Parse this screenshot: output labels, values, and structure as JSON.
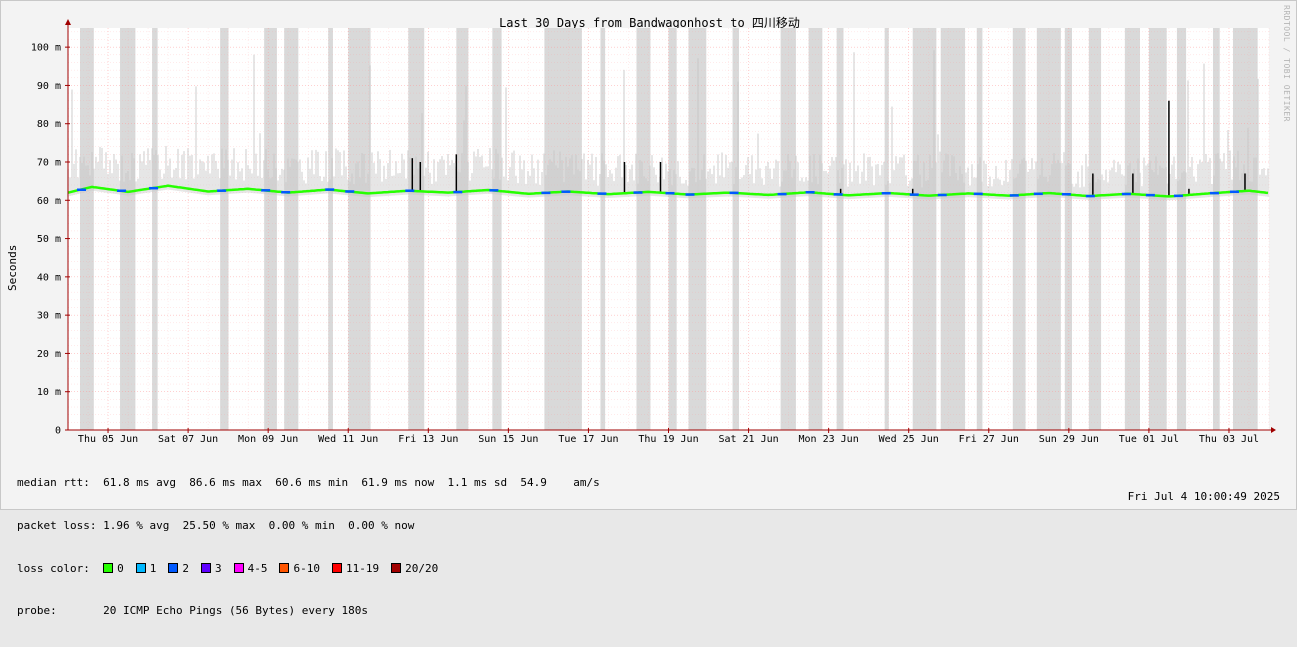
{
  "chart_data": {
    "type": "line",
    "title": "Last 30 Days from Bandwagonhost to 四川移动",
    "ylabel": "Seconds",
    "ylim": [
      0,
      105
    ],
    "y_ticks": [
      {
        "value": 0,
        "label": "0"
      },
      {
        "value": 10,
        "label": "10 m"
      },
      {
        "value": 20,
        "label": "20 m"
      },
      {
        "value": 30,
        "label": "30 m"
      },
      {
        "value": 40,
        "label": "40 m"
      },
      {
        "value": 50,
        "label": "50 m"
      },
      {
        "value": 60,
        "label": "60 m"
      },
      {
        "value": 70,
        "label": "70 m"
      },
      {
        "value": 80,
        "label": "80 m"
      },
      {
        "value": 90,
        "label": "90 m"
      },
      {
        "value": 100,
        "label": "100 m"
      }
    ],
    "x_tick_labels": [
      "Thu 05 Jun",
      "Sat 07 Jun",
      "Mon 09 Jun",
      "Wed 11 Jun",
      "Fri 13 Jun",
      "Sun 15 Jun",
      "Tue 17 Jun",
      "Thu 19 Jun",
      "Sat 21 Jun",
      "Mon 23 Jun",
      "Wed 25 Jun",
      "Fri 27 Jun",
      "Sun 29 Jun",
      "Tue 01 Jul",
      "Thu 03 Jul"
    ],
    "x_days_span": 30,
    "median_rtt_ms": [
      {
        "day": 0,
        "value": 62.0
      },
      {
        "day": 0.6,
        "value": 63.5
      },
      {
        "day": 1.5,
        "value": 62.2
      },
      {
        "day": 2.5,
        "value": 63.8
      },
      {
        "day": 3.5,
        "value": 62.3
      },
      {
        "day": 4.5,
        "value": 63.0
      },
      {
        "day": 5.5,
        "value": 62.0
      },
      {
        "day": 6.5,
        "value": 62.8
      },
      {
        "day": 7.5,
        "value": 61.8
      },
      {
        "day": 8.5,
        "value": 62.5
      },
      {
        "day": 9.5,
        "value": 62.0
      },
      {
        "day": 10.5,
        "value": 62.7
      },
      {
        "day": 11.5,
        "value": 61.7
      },
      {
        "day": 12.5,
        "value": 62.3
      },
      {
        "day": 13.5,
        "value": 61.6
      },
      {
        "day": 14.5,
        "value": 62.2
      },
      {
        "day": 15.5,
        "value": 61.5
      },
      {
        "day": 16.5,
        "value": 62.0
      },
      {
        "day": 17.5,
        "value": 61.4
      },
      {
        "day": 18.5,
        "value": 62.1
      },
      {
        "day": 19.5,
        "value": 61.3
      },
      {
        "day": 20.5,
        "value": 61.9
      },
      {
        "day": 21.5,
        "value": 61.2
      },
      {
        "day": 22.5,
        "value": 61.8
      },
      {
        "day": 23.5,
        "value": 61.2
      },
      {
        "day": 24.5,
        "value": 61.9
      },
      {
        "day": 25.5,
        "value": 61.1
      },
      {
        "day": 26.5,
        "value": 61.7
      },
      {
        "day": 27.5,
        "value": 61.0
      },
      {
        "day": 28.5,
        "value": 61.8
      },
      {
        "day": 29.5,
        "value": 62.5
      },
      {
        "day": 30,
        "value": 61.9
      }
    ],
    "spikes_ms": [
      {
        "day": 8.6,
        "value": 71
      },
      {
        "day": 8.8,
        "value": 70
      },
      {
        "day": 9.7,
        "value": 72
      },
      {
        "day": 13.9,
        "value": 70
      },
      {
        "day": 14.8,
        "value": 70
      },
      {
        "day": 19.3,
        "value": 63
      },
      {
        "day": 21.1,
        "value": 63
      },
      {
        "day": 25.6,
        "value": 67
      },
      {
        "day": 26.6,
        "value": 67
      },
      {
        "day": 27.5,
        "value": 86
      },
      {
        "day": 28.0,
        "value": 63
      },
      {
        "day": 29.4,
        "value": 67
      }
    ],
    "loss_days": [
      0.3,
      1.3,
      2.1,
      3.8,
      4.9,
      5.4,
      6.5,
      7.0,
      8.5,
      9.7,
      10.6,
      11.9,
      12.4,
      13.3,
      14.2,
      15.0,
      15.5,
      16.6,
      17.8,
      18.5,
      19.2,
      20.4,
      21.1,
      21.8,
      22.7,
      23.6,
      24.2,
      24.9,
      25.5,
      26.4,
      27.0,
      27.7,
      28.6,
      29.1
    ],
    "series_colors": {
      "loss_0": "#26ff00",
      "loss_1": "#00b8ff",
      "loss_2": "#0059ff",
      "loss_3": "#5e00ff",
      "loss_4_5": "#ff00ff",
      "loss_6_10": "#ff5500",
      "loss_11_19": "#ff0000",
      "loss_20": "#a10000",
      "smoke": "#c8c8c8",
      "grid": "#ff9999",
      "axis": "#a00000"
    }
  },
  "side_text": "RRDTOOL / TOBI OETIKER",
  "stats": {
    "median_label": "median rtt:",
    "median_values": "61.8 ms avg  86.6 ms max  60.6 ms min  61.9 ms now  1.1 ms sd  54.9    am/s",
    "loss_label": "packet loss:",
    "loss_values": "1.96 % avg  25.50 % max  0.00 % min  0.00 % now",
    "color_label": "loss color:",
    "loss_colors": [
      {
        "label": "0",
        "color": "#26ff00"
      },
      {
        "label": "1",
        "color": "#00b8ff"
      },
      {
        "label": "2",
        "color": "#0059ff"
      },
      {
        "label": "3",
        "color": "#5e00ff"
      },
      {
        "label": "4-5",
        "color": "#ff00ff"
      },
      {
        "label": "6-10",
        "color": "#ff5500"
      },
      {
        "label": "11-19",
        "color": "#ff0000"
      },
      {
        "label": "20/20",
        "color": "#a10000"
      }
    ],
    "probe_label": "probe:",
    "probe_value": "20 ICMP Echo Pings (56 Bytes) every 180s",
    "datetime": "Fri Jul  4 10:00:49 2025"
  }
}
